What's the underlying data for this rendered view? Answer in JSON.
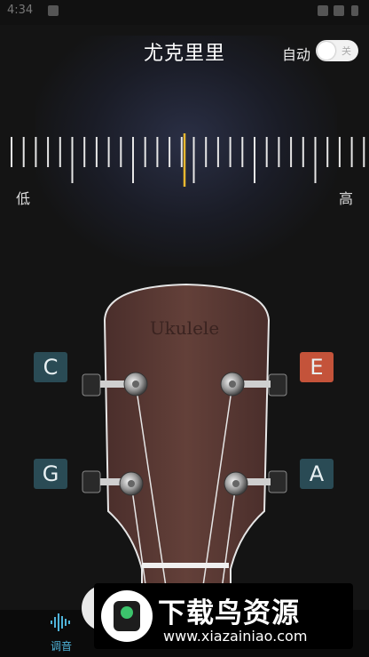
{
  "status_bar": {
    "time": "4:34"
  },
  "header": {
    "title": "尤克里里",
    "auto_label": "自动",
    "auto_toggle_state": "关"
  },
  "ruler": {
    "low_label": "低",
    "high_label": "高",
    "needle_color": "#e8b830"
  },
  "headstock": {
    "brand": "Ukulele",
    "wood_color": "#5b3a34"
  },
  "strings": [
    {
      "note": "C",
      "color": "#2a4b55"
    },
    {
      "note": "E",
      "color": "#c4533a"
    },
    {
      "note": "G",
      "color": "#2a4b55"
    },
    {
      "note": "A",
      "color": "#2a4b55"
    }
  ],
  "bottom_nav": {
    "tune_label": "调音"
  },
  "watermark": {
    "title": "下载鸟资源",
    "url": "www.xiazainiao.com"
  }
}
